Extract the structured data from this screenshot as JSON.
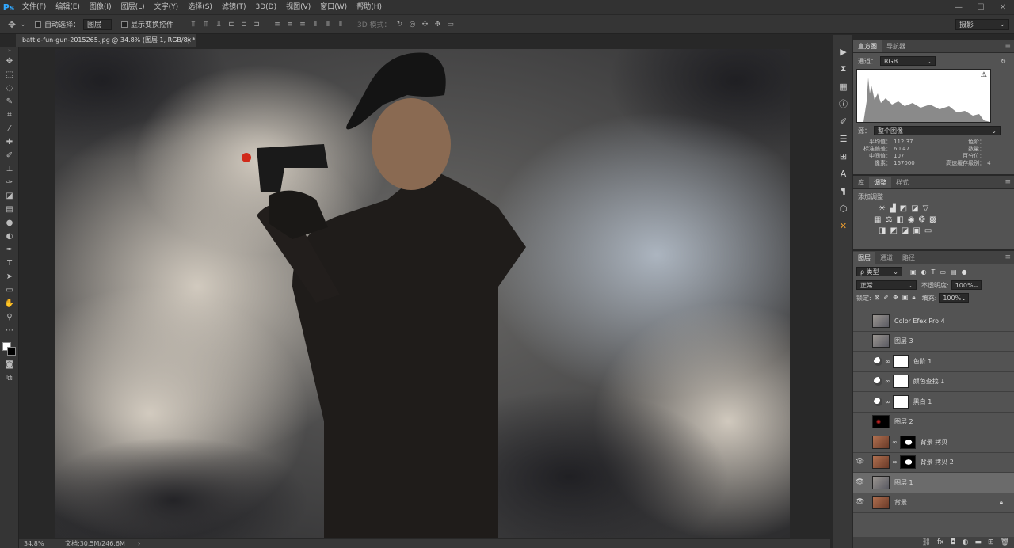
{
  "app": {
    "logo": "Ps"
  },
  "menu": [
    "文件(F)",
    "编辑(E)",
    "图像(I)",
    "图层(L)",
    "文字(Y)",
    "选择(S)",
    "滤镜(T)",
    "3D(D)",
    "视图(V)",
    "窗口(W)",
    "帮助(H)"
  ],
  "window_controls": {
    "min": "—",
    "max": "☐",
    "close": "✕"
  },
  "options": {
    "auto_select_label": "自动选择：",
    "auto_select_value": "图层",
    "show_transform_label": "显示变换控件",
    "mode3d_label": "3D 模式：",
    "workspace_value": "摄影"
  },
  "document": {
    "tab_title": "battle-fun-gun-2015265.jpg @ 34.8% (图层 1, RGB/8) *",
    "close": "×"
  },
  "status": {
    "zoom": "34.8%",
    "doc_size": "文档:30.5M/246.6M"
  },
  "histogram": {
    "tabs": [
      "直方图",
      "导航器"
    ],
    "channel_label": "通道：",
    "channel_value": "RGB",
    "source_label": "源：",
    "source_value": "整个图像",
    "stats_left": [
      {
        "label": "平均值：",
        "value": "112.37"
      },
      {
        "label": "标准偏差：",
        "value": "60.47"
      },
      {
        "label": "中间值：",
        "value": "107"
      },
      {
        "label": "像素：",
        "value": "167000"
      }
    ],
    "stats_right": [
      {
        "label": "色阶：",
        "value": ""
      },
      {
        "label": "数量：",
        "value": ""
      },
      {
        "label": "百分位：",
        "value": ""
      },
      {
        "label": "高速缓存级别：",
        "value": "4"
      }
    ]
  },
  "adjustments": {
    "tabs": [
      "库",
      "调整",
      "样式"
    ],
    "add_label": "添加调整"
  },
  "layers_panel": {
    "tabs": [
      "图层",
      "通道",
      "路径"
    ],
    "filter_label": "ρ 类型",
    "blend_mode": "正常",
    "opacity_label": "不透明度:",
    "opacity_value": "100%",
    "lock_label": "锁定:",
    "fill_label": "填充:",
    "fill_value": "100%",
    "layers": [
      {
        "name": "Color Efex Pro 4",
        "visible": false,
        "kind": "image"
      },
      {
        "name": "图层 3",
        "visible": false,
        "kind": "image"
      },
      {
        "name": "色阶 1",
        "visible": false,
        "kind": "adjust"
      },
      {
        "name": "颜色查找 1",
        "visible": false,
        "kind": "adjust"
      },
      {
        "name": "黑白 1",
        "visible": false,
        "kind": "adjust"
      },
      {
        "name": "图层 2",
        "visible": false,
        "kind": "dark"
      },
      {
        "name": "背景 拷贝",
        "visible": false,
        "kind": "masked"
      },
      {
        "name": "背景 拷贝 2",
        "visible": true,
        "kind": "masked"
      },
      {
        "name": "图层 1",
        "visible": true,
        "kind": "image",
        "selected": true
      },
      {
        "name": "背景",
        "visible": true,
        "kind": "photo",
        "locked": true
      }
    ]
  },
  "colors": {
    "accent": "#31a8ff",
    "panel": "#535353",
    "selected": "#6b6b6b"
  }
}
